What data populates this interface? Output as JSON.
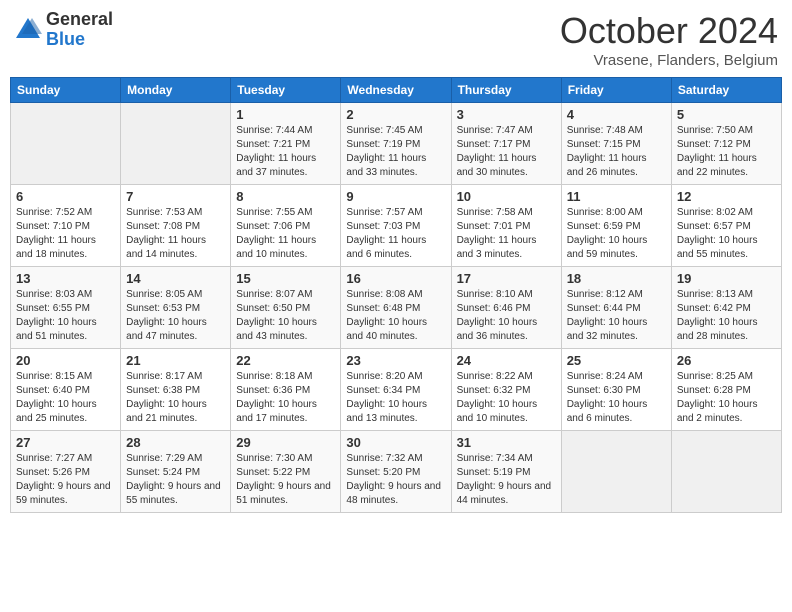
{
  "header": {
    "logo_general": "General",
    "logo_blue": "Blue",
    "month_title": "October 2024",
    "subtitle": "Vrasene, Flanders, Belgium"
  },
  "days_of_week": [
    "Sunday",
    "Monday",
    "Tuesday",
    "Wednesday",
    "Thursday",
    "Friday",
    "Saturday"
  ],
  "weeks": [
    [
      {
        "day": "",
        "info": ""
      },
      {
        "day": "",
        "info": ""
      },
      {
        "day": "1",
        "info": "Sunrise: 7:44 AM\nSunset: 7:21 PM\nDaylight: 11 hours and 37 minutes."
      },
      {
        "day": "2",
        "info": "Sunrise: 7:45 AM\nSunset: 7:19 PM\nDaylight: 11 hours and 33 minutes."
      },
      {
        "day": "3",
        "info": "Sunrise: 7:47 AM\nSunset: 7:17 PM\nDaylight: 11 hours and 30 minutes."
      },
      {
        "day": "4",
        "info": "Sunrise: 7:48 AM\nSunset: 7:15 PM\nDaylight: 11 hours and 26 minutes."
      },
      {
        "day": "5",
        "info": "Sunrise: 7:50 AM\nSunset: 7:12 PM\nDaylight: 11 hours and 22 minutes."
      }
    ],
    [
      {
        "day": "6",
        "info": "Sunrise: 7:52 AM\nSunset: 7:10 PM\nDaylight: 11 hours and 18 minutes."
      },
      {
        "day": "7",
        "info": "Sunrise: 7:53 AM\nSunset: 7:08 PM\nDaylight: 11 hours and 14 minutes."
      },
      {
        "day": "8",
        "info": "Sunrise: 7:55 AM\nSunset: 7:06 PM\nDaylight: 11 hours and 10 minutes."
      },
      {
        "day": "9",
        "info": "Sunrise: 7:57 AM\nSunset: 7:03 PM\nDaylight: 11 hours and 6 minutes."
      },
      {
        "day": "10",
        "info": "Sunrise: 7:58 AM\nSunset: 7:01 PM\nDaylight: 11 hours and 3 minutes."
      },
      {
        "day": "11",
        "info": "Sunrise: 8:00 AM\nSunset: 6:59 PM\nDaylight: 10 hours and 59 minutes."
      },
      {
        "day": "12",
        "info": "Sunrise: 8:02 AM\nSunset: 6:57 PM\nDaylight: 10 hours and 55 minutes."
      }
    ],
    [
      {
        "day": "13",
        "info": "Sunrise: 8:03 AM\nSunset: 6:55 PM\nDaylight: 10 hours and 51 minutes."
      },
      {
        "day": "14",
        "info": "Sunrise: 8:05 AM\nSunset: 6:53 PM\nDaylight: 10 hours and 47 minutes."
      },
      {
        "day": "15",
        "info": "Sunrise: 8:07 AM\nSunset: 6:50 PM\nDaylight: 10 hours and 43 minutes."
      },
      {
        "day": "16",
        "info": "Sunrise: 8:08 AM\nSunset: 6:48 PM\nDaylight: 10 hours and 40 minutes."
      },
      {
        "day": "17",
        "info": "Sunrise: 8:10 AM\nSunset: 6:46 PM\nDaylight: 10 hours and 36 minutes."
      },
      {
        "day": "18",
        "info": "Sunrise: 8:12 AM\nSunset: 6:44 PM\nDaylight: 10 hours and 32 minutes."
      },
      {
        "day": "19",
        "info": "Sunrise: 8:13 AM\nSunset: 6:42 PM\nDaylight: 10 hours and 28 minutes."
      }
    ],
    [
      {
        "day": "20",
        "info": "Sunrise: 8:15 AM\nSunset: 6:40 PM\nDaylight: 10 hours and 25 minutes."
      },
      {
        "day": "21",
        "info": "Sunrise: 8:17 AM\nSunset: 6:38 PM\nDaylight: 10 hours and 21 minutes."
      },
      {
        "day": "22",
        "info": "Sunrise: 8:18 AM\nSunset: 6:36 PM\nDaylight: 10 hours and 17 minutes."
      },
      {
        "day": "23",
        "info": "Sunrise: 8:20 AM\nSunset: 6:34 PM\nDaylight: 10 hours and 13 minutes."
      },
      {
        "day": "24",
        "info": "Sunrise: 8:22 AM\nSunset: 6:32 PM\nDaylight: 10 hours and 10 minutes."
      },
      {
        "day": "25",
        "info": "Sunrise: 8:24 AM\nSunset: 6:30 PM\nDaylight: 10 hours and 6 minutes."
      },
      {
        "day": "26",
        "info": "Sunrise: 8:25 AM\nSunset: 6:28 PM\nDaylight: 10 hours and 2 minutes."
      }
    ],
    [
      {
        "day": "27",
        "info": "Sunrise: 7:27 AM\nSunset: 5:26 PM\nDaylight: 9 hours and 59 minutes."
      },
      {
        "day": "28",
        "info": "Sunrise: 7:29 AM\nSunset: 5:24 PM\nDaylight: 9 hours and 55 minutes."
      },
      {
        "day": "29",
        "info": "Sunrise: 7:30 AM\nSunset: 5:22 PM\nDaylight: 9 hours and 51 minutes."
      },
      {
        "day": "30",
        "info": "Sunrise: 7:32 AM\nSunset: 5:20 PM\nDaylight: 9 hours and 48 minutes."
      },
      {
        "day": "31",
        "info": "Sunrise: 7:34 AM\nSunset: 5:19 PM\nDaylight: 9 hours and 44 minutes."
      },
      {
        "day": "",
        "info": ""
      },
      {
        "day": "",
        "info": ""
      }
    ]
  ]
}
